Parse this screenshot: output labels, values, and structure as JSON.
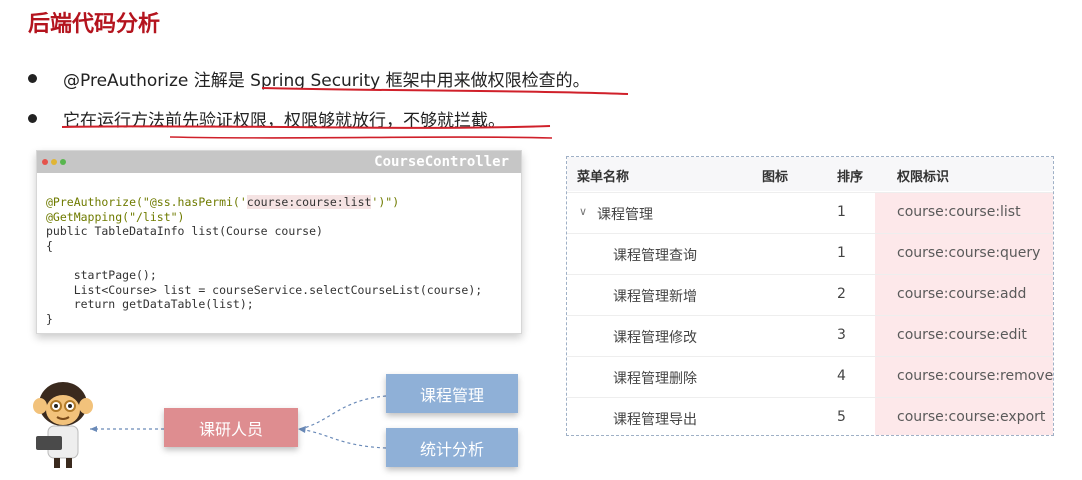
{
  "slide": {
    "title": "后端代码分析",
    "bullets": [
      "@PreAuthorize 注解是 Spring Security 框架中用来做权限检查的。",
      "它在运行方法前先验证权限，权限够就放行，不够就拦截。"
    ]
  },
  "code": {
    "window_title": "CourseController",
    "lines": {
      "l1_pre": "@PreAuthorize(\"@ss.hasPermi('",
      "l1_perm": "course:course:list",
      "l1_post": "')\")",
      "l2": "@GetMapping(\"/list\")",
      "l3": "public TableDataInfo list(Course course)",
      "l4": "{",
      "l5": "    startPage();",
      "l6": "    List<Course> list = courseService.selectCourseList(course);",
      "l7": "    return getDataTable(list);",
      "l8": "}"
    }
  },
  "menu_table": {
    "headers": [
      "菜单名称",
      "图标",
      "排序",
      "权限标识"
    ],
    "rows": [
      {
        "name": "课程管理",
        "sort": "1",
        "perm": "course:course:list"
      },
      {
        "name": "课程管理查询",
        "sort": "1",
        "perm": "course:course:query"
      },
      {
        "name": "课程管理新增",
        "sort": "2",
        "perm": "course:course:add"
      },
      {
        "name": "课程管理修改",
        "sort": "3",
        "perm": "course:course:edit"
      },
      {
        "name": "课程管理删除",
        "sort": "4",
        "perm": "course:course:remove"
      },
      {
        "name": "课程管理导出",
        "sort": "5",
        "perm": "course:course:export"
      }
    ]
  },
  "diagram": {
    "role": "课研人员",
    "menus": [
      "课程管理",
      "统计分析"
    ]
  },
  "colors": {
    "title": "#b4141e",
    "underline": "#d0202a",
    "role_box": "#de8d90",
    "menu_box": "#8fb0d7",
    "perm_bg": "#fde8ea"
  }
}
